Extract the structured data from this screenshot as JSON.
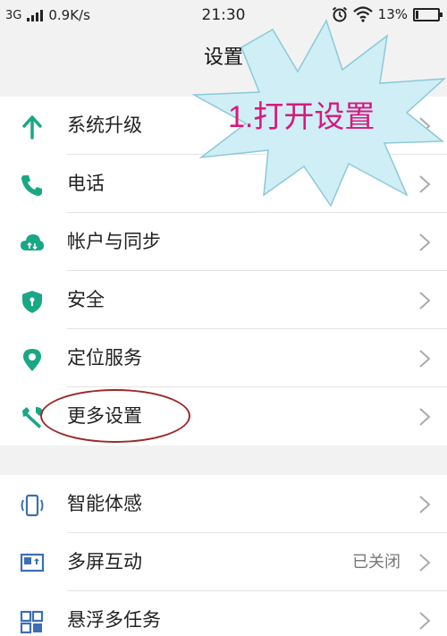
{
  "status_bar": {
    "network": "3G",
    "speed": "0.9K/s",
    "time": "21:30",
    "battery": "13%",
    "battery_level": 0.13,
    "icons": [
      "signal-icon",
      "alarm-icon",
      "wifi-icon",
      "battery-icon"
    ]
  },
  "header": {
    "title": "设置"
  },
  "sections": [
    {
      "items": [
        {
          "label": "系统升级",
          "icon": "arrow-up-icon"
        },
        {
          "label": "电话",
          "icon": "phone-icon"
        },
        {
          "label": "帐户与同步",
          "icon": "cloud-sync-icon"
        },
        {
          "label": "安全",
          "icon": "shield-icon"
        },
        {
          "label": "定位服务",
          "icon": "location-pin-icon"
        },
        {
          "label": "更多设置",
          "icon": "wrench-icon"
        }
      ]
    },
    {
      "items": [
        {
          "label": "智能体感",
          "icon": "phone-motion-icon"
        },
        {
          "label": "多屏互动",
          "icon": "screen-cast-icon",
          "value": "已关闭"
        },
        {
          "label": "悬浮多任务",
          "icon": "floating-window-icon"
        }
      ]
    }
  ],
  "annotation": {
    "text": "1.打开设置"
  },
  "colors": {
    "accent_green": "#1aa784",
    "accent_blue": "#3b6fb6",
    "annotation_pink": "#d8187e",
    "callout_fill": "#cfeef5"
  }
}
